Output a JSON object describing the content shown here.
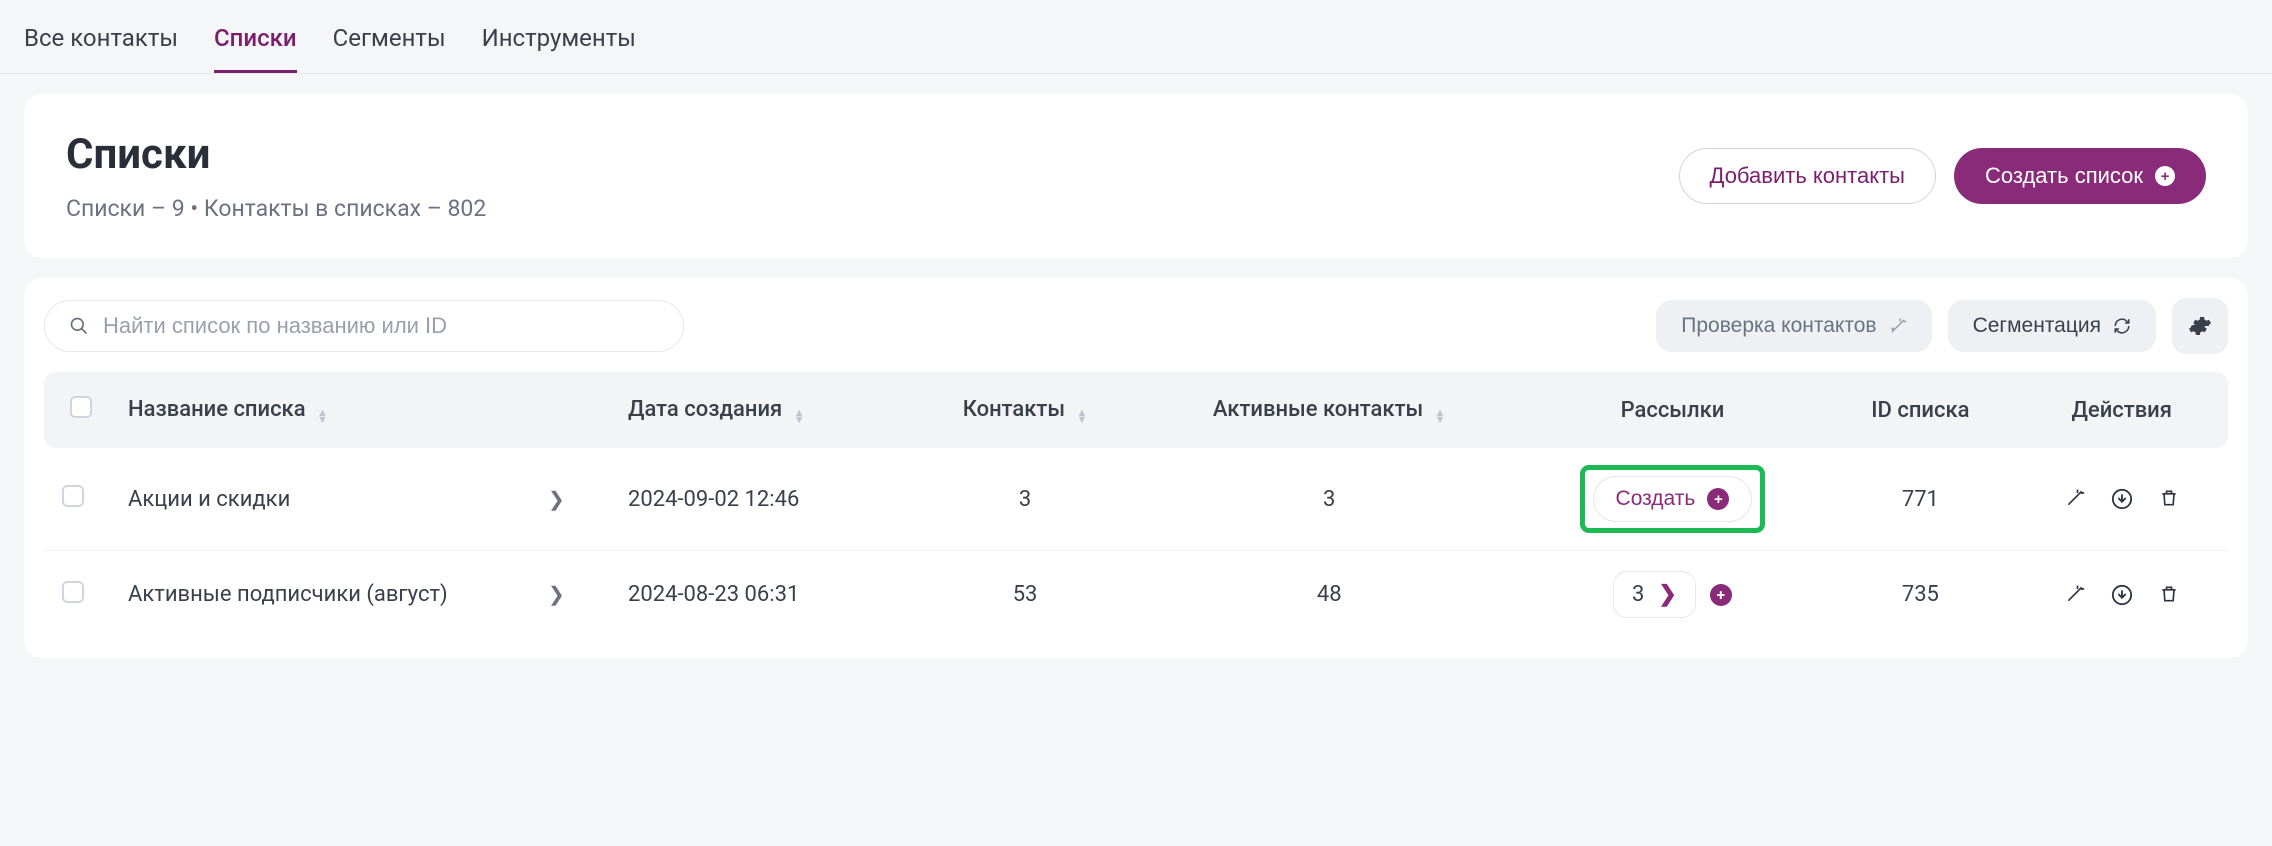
{
  "tabs": [
    {
      "label": "Все контакты"
    },
    {
      "label": "Списки"
    },
    {
      "label": "Сегменты"
    },
    {
      "label": "Инструменты"
    }
  ],
  "activeTab": 1,
  "header": {
    "title": "Списки",
    "subtitle": "Списки – 9 • Контакты в списках – 802",
    "addContacts": "Добавить контакты",
    "createList": "Создать список"
  },
  "toolbar": {
    "searchPlaceholder": "Найти список по названию или ID",
    "verify": "Проверка контактов",
    "segment": "Сегментация"
  },
  "columns": {
    "name": "Название списка",
    "date": "Дата создания",
    "contacts": "Контакты",
    "active": "Активные контакты",
    "mailings": "Рассылки",
    "id": "ID списка",
    "actions": "Действия"
  },
  "rows": [
    {
      "name": "Акции и скидки",
      "date": "2024-09-02 12:46",
      "contacts": "3",
      "active": "3",
      "mailLabel": "Создать",
      "mailCount": null,
      "id": "771",
      "highlight": true
    },
    {
      "name": "Активные подписчики (август)",
      "date": "2024-08-23 06:31",
      "contacts": "53",
      "active": "48",
      "mailLabel": null,
      "mailCount": "3",
      "id": "735",
      "highlight": false
    }
  ]
}
